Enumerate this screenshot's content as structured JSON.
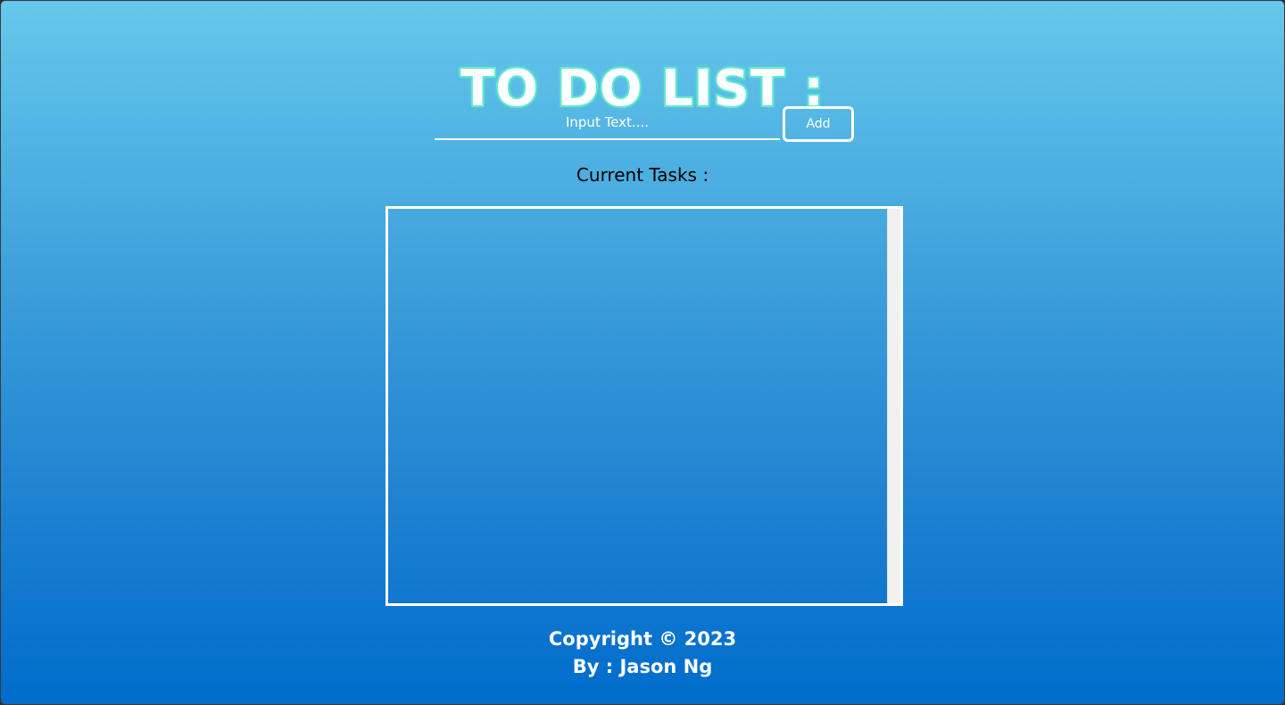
{
  "header": {
    "title": "TO DO LIST :"
  },
  "input": {
    "placeholder": "Input Text....",
    "value": ""
  },
  "buttons": {
    "add_label": "Add"
  },
  "tasks": {
    "heading": "Current Tasks :",
    "items": []
  },
  "footer": {
    "copyright": "Copyright © 2023",
    "author": "By : Jason Ng"
  },
  "colors": {
    "gradient_top": "#66c8ec",
    "gradient_bottom": "#006ccc",
    "title_outline": "#5de8c8",
    "text_light": "#ffffff",
    "text_dark": "#000000"
  }
}
